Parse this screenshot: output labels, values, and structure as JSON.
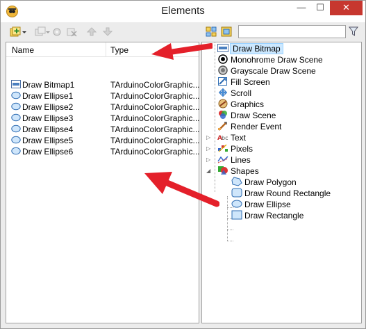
{
  "window": {
    "title": "Elements",
    "min_glyph": "—",
    "max_glyph": "☐",
    "close_glyph": "✕"
  },
  "toolbar_left": [
    {
      "icon": "add-element-icon"
    },
    {
      "icon": "dropdown-icon"
    },
    {
      "icon": "copy-element-icon"
    },
    {
      "icon": "delete-element-icon"
    },
    {
      "icon": "move-up-icon"
    },
    {
      "icon": "move-down-icon"
    }
  ],
  "list": {
    "columns": [
      "Name",
      "Type"
    ],
    "rows": [
      {
        "name": "Draw Bitmap1",
        "type": "TArduinoColorGraphic...",
        "icon": "bitmap-icon"
      },
      {
        "name": "Draw Ellipse1",
        "type": "TArduinoColorGraphic...",
        "icon": "ellipse-icon"
      },
      {
        "name": "Draw Ellipse2",
        "type": "TArduinoColorGraphic...",
        "icon": "ellipse-icon"
      },
      {
        "name": "Draw Ellipse3",
        "type": "TArduinoColorGraphic...",
        "icon": "ellipse-icon"
      },
      {
        "name": "Draw Ellipse4",
        "type": "TArduinoColorGraphic...",
        "icon": "ellipse-icon"
      },
      {
        "name": "Draw Ellipse5",
        "type": "TArduinoColorGraphic...",
        "icon": "ellipse-icon"
      },
      {
        "name": "Draw Ellipse6",
        "type": "TArduinoColorGraphic...",
        "icon": "ellipse-icon"
      }
    ]
  },
  "search": {
    "value": "",
    "placeholder": ""
  },
  "tree": [
    {
      "label": "Draw Bitmap",
      "icon": "bitmap-icon",
      "selected": true
    },
    {
      "label": "Monohrome Draw Scene",
      "icon": "mono-scene-icon"
    },
    {
      "label": "Grayscale Draw Scene",
      "icon": "gray-scene-icon"
    },
    {
      "label": "Fill Screen",
      "icon": "fill-screen-icon"
    },
    {
      "label": "Scroll",
      "icon": "scroll-icon"
    },
    {
      "label": "Graphics",
      "icon": "graphics-icon"
    },
    {
      "label": "Draw Scene",
      "icon": "draw-scene-icon"
    },
    {
      "label": "Render Event",
      "icon": "render-event-icon"
    },
    {
      "label": "Text",
      "icon": "text-icon",
      "expandable": true
    },
    {
      "label": "Pixels",
      "icon": "pixels-icon",
      "expandable": true
    },
    {
      "label": "Lines",
      "icon": "lines-icon",
      "expandable": true
    },
    {
      "label": "Shapes",
      "icon": "shapes-icon",
      "expanded": true
    },
    {
      "label": "Draw Polygon",
      "icon": "polygon-icon",
      "child": true
    },
    {
      "label": "Draw Round Rectangle",
      "icon": "round-rect-icon",
      "child": true
    },
    {
      "label": "Draw Ellipse",
      "icon": "ellipse-icon",
      "child": true
    },
    {
      "label": "Draw Rectangle",
      "icon": "rectangle-icon",
      "child": true
    }
  ],
  "colors": {
    "annotation_arrow": "#e4202a",
    "selection": "#cce8ff",
    "close_button": "#c7372f"
  }
}
